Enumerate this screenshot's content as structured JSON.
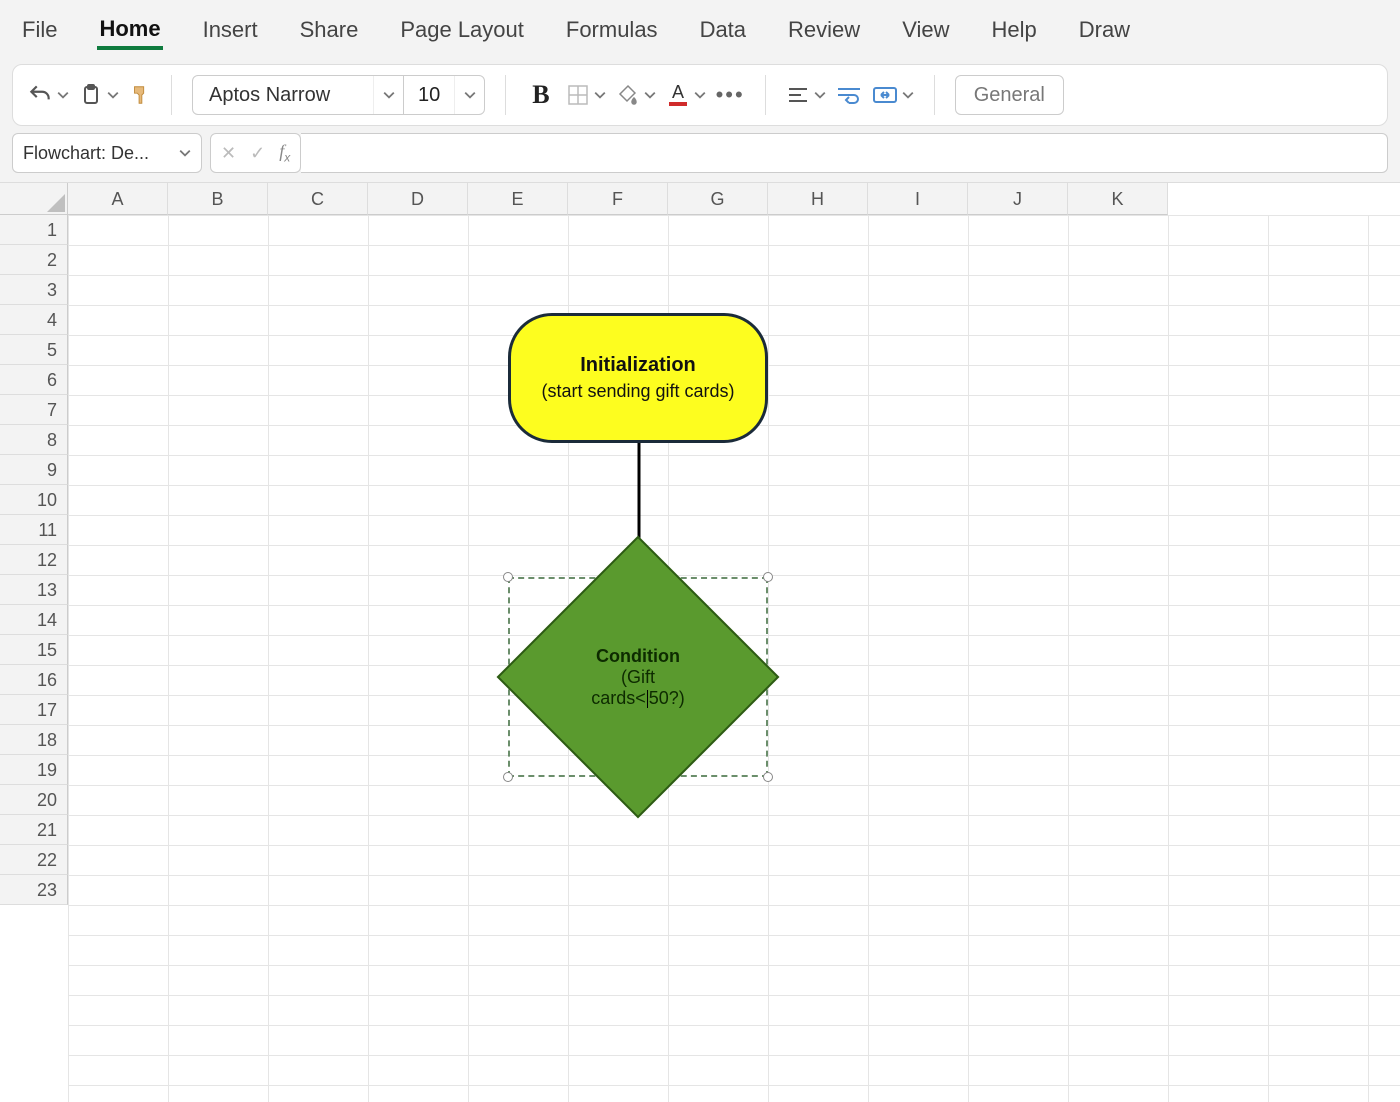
{
  "menu": {
    "items": [
      "File",
      "Home",
      "Insert",
      "Share",
      "Page Layout",
      "Formulas",
      "Data",
      "Review",
      "View",
      "Help",
      "Draw"
    ],
    "active": "Home"
  },
  "ribbon": {
    "font_name": "Aptos Narrow",
    "font_size": "10",
    "number_format": "General"
  },
  "namebox": {
    "value": "Flowchart: De..."
  },
  "grid": {
    "columns": [
      "A",
      "B",
      "C",
      "D",
      "E",
      "F",
      "G",
      "H",
      "I",
      "J",
      "K"
    ],
    "rows": [
      "1",
      "2",
      "3",
      "4",
      "5",
      "6",
      "7",
      "8",
      "9",
      "10",
      "11",
      "12",
      "13",
      "14",
      "15",
      "16",
      "17",
      "18",
      "19",
      "20",
      "21",
      "22",
      "23"
    ]
  },
  "shapes": {
    "terminator": {
      "title": "Initialization",
      "subtitle": "(start sending gift cards)"
    },
    "decision": {
      "title": "Condition",
      "line2a": "(Gift",
      "line2b_before": "cards<",
      "line2b_after": "50?)"
    }
  }
}
